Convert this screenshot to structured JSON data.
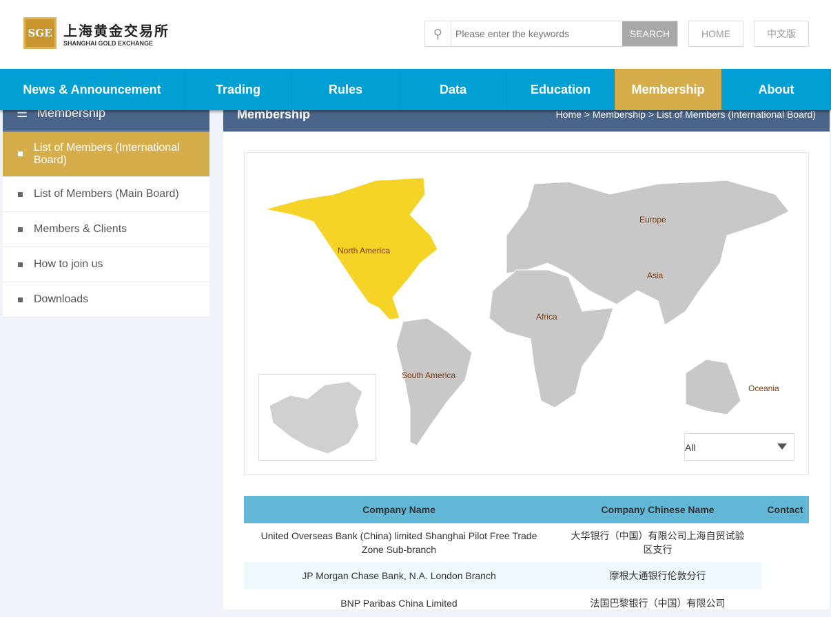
{
  "header": {
    "logo_cn": "上海黄金交易所",
    "logo_en": "SHANGHAI GOLD EXCHANGE",
    "logo_mark": "SGE",
    "search_placeholder": "Please enter the keywords",
    "search_label": "SEARCH",
    "home_label": "HOME",
    "lang_label": "中文版"
  },
  "nav": [
    "News & Announcement",
    "Trading",
    "Rules",
    "Data",
    "Education",
    "Membership",
    "About"
  ],
  "sidebar": {
    "title": "Membership",
    "items": [
      "List of Members (International Board)",
      "List of Members (Main Board)",
      "Members & Clients",
      "How to join us",
      "Downloads"
    ]
  },
  "page": {
    "title": "Membership",
    "breadcrumb": [
      "Home",
      "Membership",
      "List of Members (International Board)"
    ],
    "sep": ">"
  },
  "map": {
    "regions": [
      "North America",
      "South America",
      "Europe",
      "Asia",
      "Africa",
      "Oceania"
    ],
    "selected": "North America",
    "filter": "All",
    "highlight_color": "#f5d327"
  },
  "table": {
    "headers": [
      "Company Name",
      "Company Chinese Name",
      "Contact"
    ],
    "rows": [
      [
        "United Overseas Bank (China) limited Shanghai Pilot Free Trade Zone Sub-branch",
        "大华银行（中国）有限公司上海自贸试验区支行",
        ""
      ],
      [
        "JP Morgan Chase Bank, N.A. London Branch",
        "摩根大通银行伦敦分行",
        ""
      ],
      [
        "BNP Paribas China Limited",
        "法国巴黎银行（中国）有限公司",
        ""
      ]
    ]
  }
}
